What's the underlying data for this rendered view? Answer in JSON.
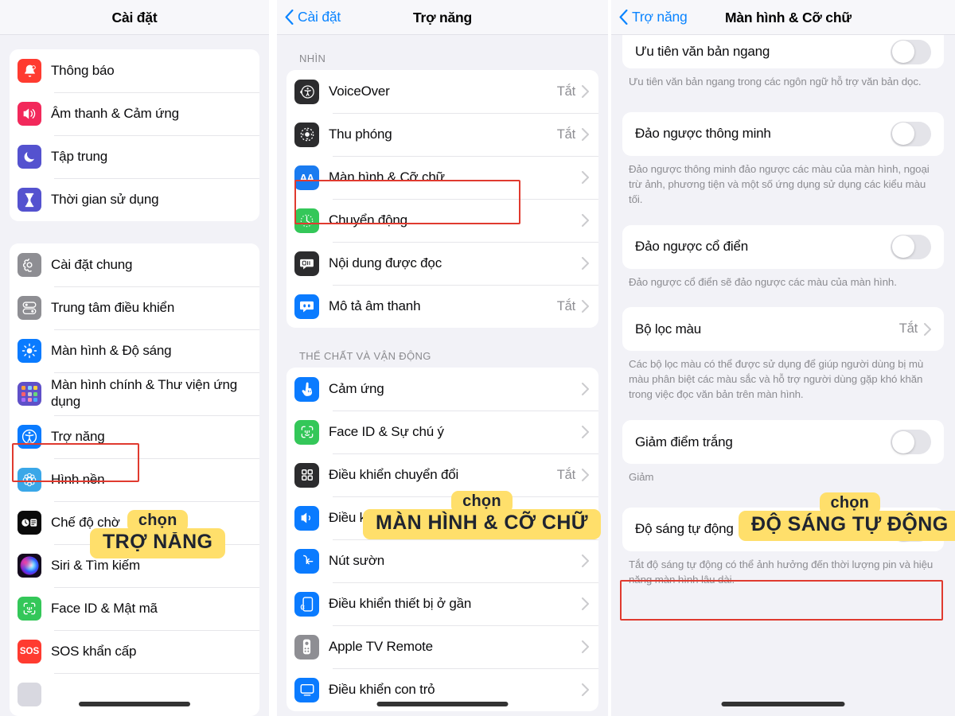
{
  "panel1": {
    "nav": {
      "title": "Cài đặt"
    },
    "group_a": [
      {
        "label": "Thông báo",
        "icon": "bell-icon"
      },
      {
        "label": "Âm thanh & Cảm ứng",
        "icon": "speaker-icon"
      },
      {
        "label": "Tập trung",
        "icon": "moon-icon"
      },
      {
        "label": "Thời gian sử dụng",
        "icon": "hourglass-icon"
      }
    ],
    "group_b": [
      {
        "label": "Cài đặt chung",
        "icon": "gear-icon"
      },
      {
        "label": "Trung tâm điều khiển",
        "icon": "control-center-icon"
      },
      {
        "label": "Màn hình & Độ sáng",
        "icon": "brightness-icon"
      },
      {
        "label": "Màn hình chính & Thư viện ứng dụng",
        "icon": "app-library-icon"
      },
      {
        "label": "Trợ năng",
        "icon": "accessibility-icon"
      },
      {
        "label": "Hình nền",
        "icon": "wallpaper-icon"
      },
      {
        "label": "Chế độ chờ",
        "icon": "standby-icon"
      },
      {
        "label": "Siri & Tìm kiếm",
        "icon": "siri-icon"
      },
      {
        "label": "Face ID & Mật mã",
        "icon": "faceid-icon"
      },
      {
        "label": "SOS khẩn cấp",
        "icon": "sos-icon"
      }
    ],
    "sticker": {
      "top": "chọn",
      "main": "TRỢ NĂNG"
    }
  },
  "panel2": {
    "nav": {
      "back": "Cài đặt",
      "title": "Trợ năng"
    },
    "section_vision": {
      "header": "NHÌN",
      "items": [
        {
          "label": "VoiceOver",
          "value": "Tắt",
          "icon": "voiceover-icon"
        },
        {
          "label": "Thu phóng",
          "value": "Tắt",
          "icon": "zoom-icon"
        },
        {
          "label": "Màn hình & Cỡ chữ",
          "value": "",
          "icon": "aa-icon"
        },
        {
          "label": "Chuyển động",
          "value": "",
          "icon": "motion-icon"
        },
        {
          "label": "Nội dung được đọc",
          "value": "",
          "icon": "spoken-content-icon"
        },
        {
          "label": "Mô tả âm thanh",
          "value": "Tắt",
          "icon": "audio-description-icon"
        }
      ]
    },
    "section_physical": {
      "header": "THỂ CHẤT VÀ VẬN ĐỘNG",
      "items": [
        {
          "label": "Cảm ứng",
          "value": "",
          "icon": "touch-icon"
        },
        {
          "label": "Face ID & Sự chú ý",
          "value": "",
          "icon": "faceid-icon"
        },
        {
          "label": "Điều khiển chuyển đổi",
          "value": "Tắt",
          "icon": "switch-control-icon"
        },
        {
          "label": "Điều khiển bằng giọng nói",
          "value": "",
          "icon": "voice-control-icon"
        },
        {
          "label": "Nút sườn",
          "value": "",
          "icon": "side-button-icon"
        },
        {
          "label": "Điều khiển thiết bị ở gần",
          "value": "",
          "icon": "nearby-device-icon"
        },
        {
          "label": "Apple TV Remote",
          "value": "",
          "icon": "apple-tv-remote-icon"
        },
        {
          "label": "Điều khiển con trỏ",
          "value": "",
          "icon": "pointer-control-icon"
        }
      ]
    },
    "sticker": {
      "top": "chọn",
      "main": "MÀN HÌNH & CỠ CHỮ"
    }
  },
  "panel3": {
    "nav": {
      "back": "Trợ năng",
      "title": "Màn hình & Cỡ chữ"
    },
    "items": [
      {
        "label": "Ưu tiên văn bản ngang",
        "type": "switch",
        "value": "off",
        "footer": "Ưu tiên văn bản ngang trong các ngôn ngữ hỗ trợ văn bản dọc."
      },
      {
        "label": "Đảo ngược thông minh",
        "type": "switch",
        "value": "off",
        "footer": "Đảo ngược thông minh đảo ngược các màu của màn hình, ngoại trừ ảnh, phương tiện và một số ứng dụng sử dụng các kiểu màu tối."
      },
      {
        "label": "Đảo ngược cổ điển",
        "type": "switch",
        "value": "off",
        "footer": "Đảo ngược cổ điển sẽ đảo ngược các màu của màn hình."
      },
      {
        "label": "Bộ lọc màu",
        "type": "disclosure",
        "value": "Tắt",
        "footer": "Các bộ lọc màu có thể được sử dụng để giúp người dùng bị mù màu phân biệt các màu sắc và hỗ trợ người dùng gặp khó khăn trong việc đọc văn bản trên màn hình."
      },
      {
        "label": "Giảm điểm trắng",
        "type": "switch",
        "value": "off",
        "footer": "Giảm"
      },
      {
        "label": "Độ sáng tự động",
        "type": "switch",
        "value": "off",
        "footer": "Tắt độ sáng tự động có thể ảnh hưởng đến thời lượng pin và hiệu năng màn hình lâu dài."
      }
    ],
    "sticker": {
      "top": "chọn",
      "main": "ĐỘ SÁNG TỰ ĐỘNG"
    }
  },
  "colors": {
    "highlight_box": "#e03a2f",
    "sticker_bg": "#ffdf6b",
    "accent_blue": "#0a84ff",
    "panel_bg": "#f2f2f7"
  }
}
